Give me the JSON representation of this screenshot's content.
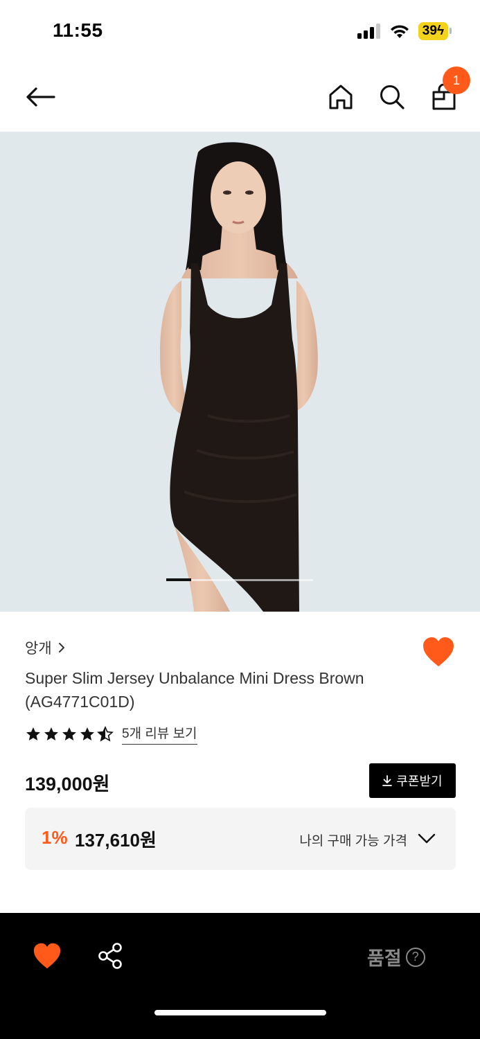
{
  "status_bar": {
    "time": "11:55",
    "battery": "39"
  },
  "header": {
    "cart_count": "1"
  },
  "product": {
    "brand": "앙개",
    "name": "Super Slim Jersey Unbalance Mini Dress Brown (AG4771C01D)",
    "rating": 4.5,
    "review_link": "5개 리뷰 보기",
    "price": "139,000원",
    "coupon_label": "쿠폰받기",
    "discount_rate": "1%",
    "discount_price": "137,610원",
    "my_price_label": "나의 구매 가능 가격"
  },
  "bottom_bar": {
    "soldout_label": "품절",
    "help_glyph": "?"
  },
  "colors": {
    "accent": "#ff5a1a",
    "black": "#000000",
    "muted": "#8a8a8a"
  },
  "icons": [
    "back-arrow-icon",
    "home-icon",
    "search-icon",
    "shopping-bag-icon",
    "heart-icon",
    "share-icon",
    "chevron-down-icon",
    "download-icon",
    "help-icon",
    "star-icon"
  ]
}
